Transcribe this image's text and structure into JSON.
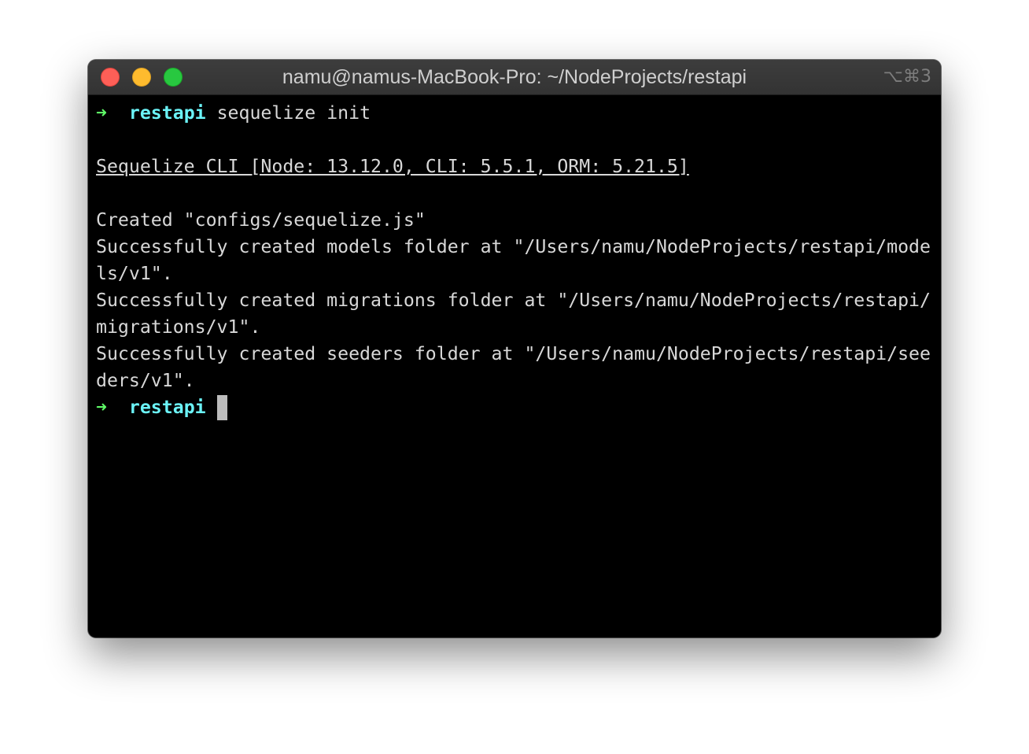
{
  "window": {
    "title": "namu@namus-MacBook-Pro: ~/NodeProjects/restapi",
    "shortcut": "⌥⌘3",
    "colors": {
      "close": "#fe5f57",
      "minimize": "#febb2e",
      "zoom": "#28c840",
      "prompt_arrow": "#5ff967",
      "prompt_dir": "#6bf3f7",
      "text": "#d8d8d8",
      "background": "#000000"
    }
  },
  "terminal": {
    "prompt1": {
      "arrow": "➜",
      "dir": "restapi",
      "command": "sequelize init"
    },
    "cli_header": "Sequelize CLI [Node: 13.12.0, CLI: 5.5.1, ORM: 5.21.5]",
    "output": [
      "Created \"configs/sequelize.js\"",
      "Successfully created models folder at \"/Users/namu/NodeProjects/restapi/mode",
      "ls/v1\".",
      "Successfully created migrations folder at \"/Users/namu/NodeProjects/restapi/",
      "migrations/v1\".",
      "Successfully created seeders folder at \"/Users/namu/NodeProjects/restapi/see",
      "ders/v1\"."
    ],
    "prompt2": {
      "arrow": "➜",
      "dir": "restapi"
    }
  }
}
